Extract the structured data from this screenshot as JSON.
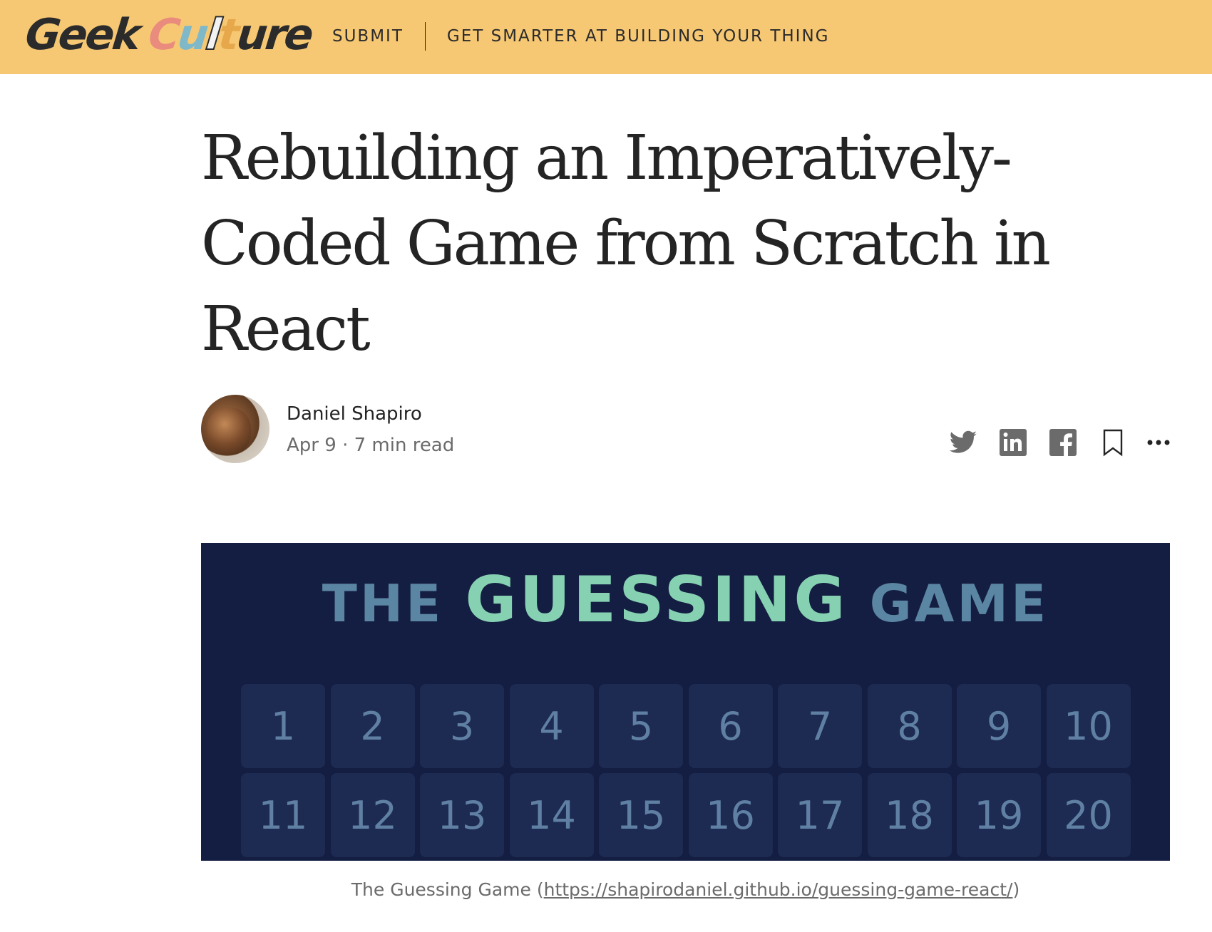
{
  "header": {
    "logo": {
      "geek": "Geek",
      "c": "C",
      "u": "u",
      "l": "l",
      "t": "t",
      "ure": "ure"
    },
    "nav": {
      "submit": "SUBMIT",
      "tagline": "GET SMARTER AT BUILDING YOUR THING"
    },
    "bg_color": "#f7c873"
  },
  "article": {
    "title": "Rebuilding an Imperatively-Coded Game from Scratch in React",
    "author": {
      "name": "Daniel Shapiro",
      "date": "Apr 9",
      "separator": "·",
      "read_time": "7 min read"
    },
    "share_icons": [
      "twitter-icon",
      "linkedin-icon",
      "facebook-icon",
      "bookmark-icon",
      "more-icon"
    ]
  },
  "hero": {
    "title_word1": "THE",
    "title_word2": "GUESSING",
    "title_word3": "GAME",
    "numbers": [
      "1",
      "2",
      "3",
      "4",
      "5",
      "6",
      "7",
      "8",
      "9",
      "10",
      "11",
      "12",
      "13",
      "14",
      "15",
      "16",
      "17",
      "18",
      "19",
      "20"
    ],
    "bg_color": "#141d42",
    "accent_color": "#86d1b2"
  },
  "caption": {
    "text": "The Guessing Game (",
    "link": "https://shapirodaniel.github.io/guessing-game-react/",
    "close": ")"
  }
}
